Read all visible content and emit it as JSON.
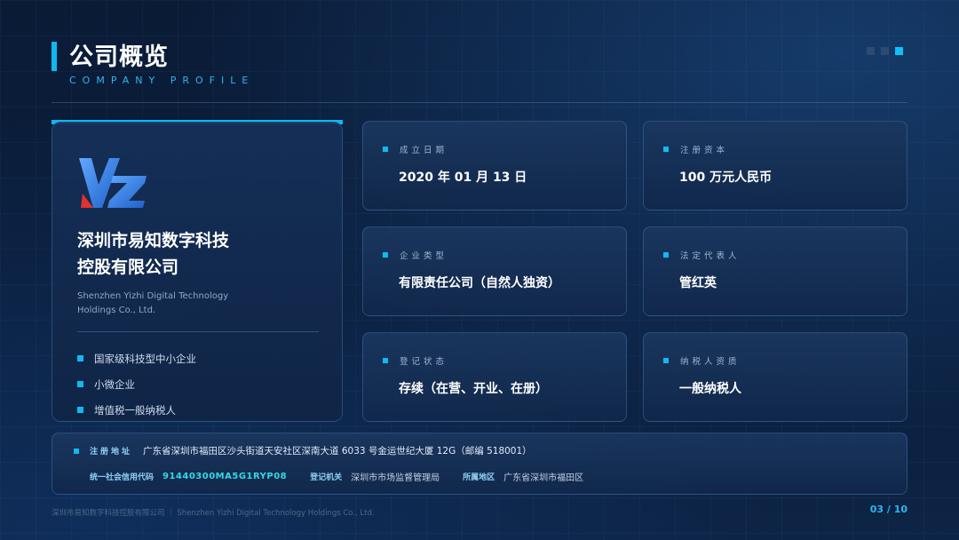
{
  "header": {
    "title": "公司概览",
    "subtitle": "COMPANY PROFILE"
  },
  "company": {
    "logo_icon": "yz-logo-icon",
    "name_line1": "深圳市易知数字科技",
    "name_line2": "控股有限公司",
    "name_en_line1": "Shenzhen Yizhi Digital Technology",
    "name_en_line2": "Holdings Co., Ltd.",
    "tags": [
      "国家级科技型中小企业",
      "小微企业",
      "增值税一般纳税人"
    ]
  },
  "info_cards": [
    {
      "label": "成立日期",
      "value": "2020 年 01 月 13 日"
    },
    {
      "label": "注册资本",
      "value": "100 万元人民币"
    },
    {
      "label": "企业类型",
      "value": "有限责任公司（自然人独资）"
    },
    {
      "label": "法定代表人",
      "value": "管红英"
    },
    {
      "label": "登记状态",
      "value": "存续（在营、开业、在册）"
    },
    {
      "label": "纳税人资质",
      "value": "一般纳税人"
    }
  ],
  "address": {
    "label": "注册地址",
    "value": "广东省深圳市福田区沙头街道天安社区深南大道 6033 号金运世纪大厦 12G（邮编 518001）",
    "credit_code_label": "统一社会信用代码",
    "credit_code": "91440300MA5G1RYP08",
    "authority_label": "登记机关",
    "authority": "深圳市市场监督管理局",
    "region_label": "所属地区",
    "region": "广东省深圳市福田区"
  },
  "footer": {
    "text": "深圳市易知数字科技控股有限公司 ｜ Shenzhen Yizhi Digital Technology Holdings Co., Ltd.",
    "page": "03 / 10"
  },
  "colors": {
    "accent": "#10b8f2",
    "background": "#0b1f3d",
    "code": "#35d7e6"
  }
}
